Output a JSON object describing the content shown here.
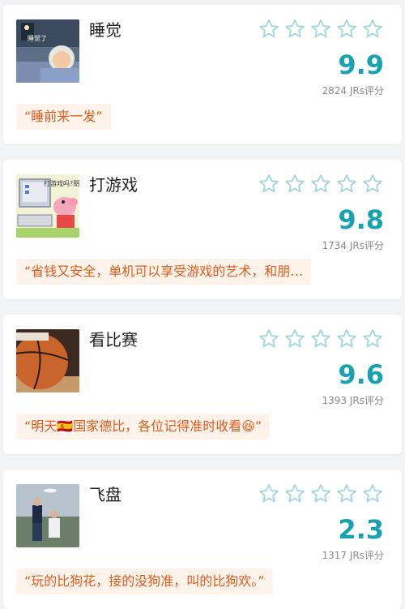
{
  "colors": {
    "accent": "#16a2b0",
    "comment_text": "#e05a1c",
    "comment_bg": "#fdf3ea",
    "star_outline": "#9fd6df"
  },
  "items": [
    {
      "title": "睡觉",
      "score": "9.9",
      "count": "2824 JRs评分",
      "comment": "“睡前来一发”",
      "thumb_icon": "sleeping-cartoon-thumbnail",
      "thumb_caption": "睡觉了"
    },
    {
      "title": "打游戏",
      "score": "9.8",
      "count": "1734 JRs评分",
      "comment": "“省钱又安全，单机可以享受游戏的艺术，和朋…",
      "thumb_icon": "peppa-pig-computer-thumbnail",
      "thumb_caption": "打游戏吗?朋友"
    },
    {
      "title": "看比赛",
      "score": "9.6",
      "count": "1393 JRs评分",
      "comment": "“明天🇪🇸国家德比，各位记得准时收看😆”",
      "thumb_icon": "basketball-thumbnail",
      "thumb_caption": ""
    },
    {
      "title": "飞盘",
      "score": "2.3",
      "count": "1317 JRs评分",
      "comment": "“玩的比狗花，接的没狗准，叫的比狗欢。”",
      "thumb_icon": "frisbee-players-thumbnail",
      "thumb_caption": ""
    }
  ],
  "star_rating_icon": "star-outline-icon"
}
